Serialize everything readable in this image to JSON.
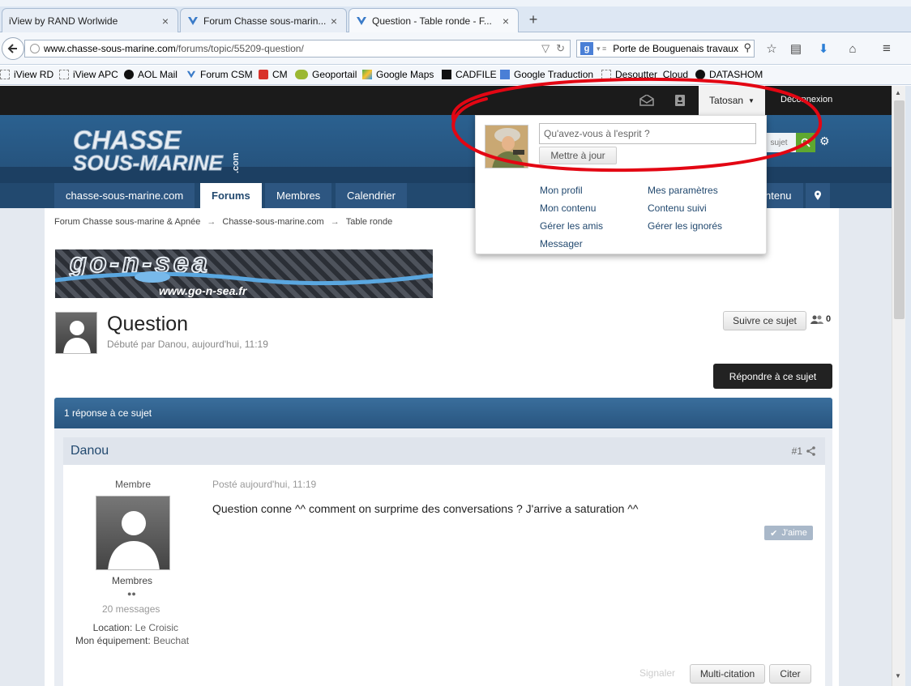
{
  "browser": {
    "tabs": [
      {
        "title": "iView by RAND Worlwide",
        "active": false
      },
      {
        "title": "Forum Chasse sous-marin...",
        "active": false
      },
      {
        "title": "Question - Table ronde - F...",
        "active": true
      }
    ],
    "new_tab": "+",
    "url": {
      "host": "www.chasse-sous-marine.com",
      "path": "/forums/topic/55209-question/"
    },
    "search": {
      "value": "Porte de Bouguenais travaux",
      "engine_letter": "g"
    },
    "bookmarks": [
      {
        "label": "iView RD"
      },
      {
        "label": "iView APC"
      },
      {
        "label": "AOL Mail"
      },
      {
        "label": "Forum CSM"
      },
      {
        "label": "CM"
      },
      {
        "label": "Geoportail"
      },
      {
        "label": "Google Maps"
      },
      {
        "label": "CADFILE"
      },
      {
        "label": "Google Traduction"
      },
      {
        "label": "Desoutter_Cloud"
      },
      {
        "label": "DATASHOM"
      }
    ]
  },
  "site": {
    "userbar": {
      "username": "Tatosan",
      "logout": "Déconnexion"
    },
    "logo": {
      "line1": "CHASSE",
      "line2": "SOUS-MARINE",
      "suffix": ".com"
    },
    "search_placeholder": "sujet",
    "nav": [
      {
        "label": "chasse-sous-marine.com"
      },
      {
        "label": "Forums"
      },
      {
        "label": "Membres"
      },
      {
        "label": "Calendrier"
      },
      {
        "label": "ntenu"
      }
    ],
    "breadcrumb": [
      "Forum Chasse sous-marine & Apnée",
      "Chasse-sous-marine.com",
      "Table ronde"
    ],
    "breadcrumb_sep": "→",
    "banner": {
      "brand": "go-n-sea",
      "url": "www.go-n-sea.fr"
    },
    "topic": {
      "title": "Question",
      "meta": "Débuté par Danou, aujourd'hui, 11:19",
      "follow": "Suivre ce sujet",
      "followers": "0",
      "reply": "Répondre à ce sujet",
      "replies_count": "1 réponse à ce sujet"
    },
    "post": {
      "author": "Danou",
      "number": "#1",
      "role": "Membre",
      "group": "Membres",
      "pips": "●●",
      "messages": "20 messages",
      "location_label": "Location:",
      "location_value": "Le Croisic",
      "equipment_label": "Mon équipement:",
      "equipment_value": "Beuchat",
      "posted": "Posté aujourd'hui, 11:19",
      "text": "Question conne ^^ comment on surprime des conversations ? J'arrive a saturation ^^",
      "like": "J'aime",
      "report": "Signaler",
      "multiquote": "Multi-citation",
      "quote": "Citer"
    },
    "dropdown": {
      "status_placeholder": "Qu'avez-vous à l'esprit ?",
      "update": "Mettre à jour",
      "links": [
        "Mon profil",
        "Mes paramètres",
        "Mon contenu",
        "Contenu suivi",
        "Gérer les amis",
        "Gérer les ignorés",
        "Messager"
      ]
    }
  },
  "colors": {
    "accent_blue": "#22496f",
    "annotation": "#e30613",
    "reply_button": "#222222",
    "search_green": "#5fa82f"
  }
}
